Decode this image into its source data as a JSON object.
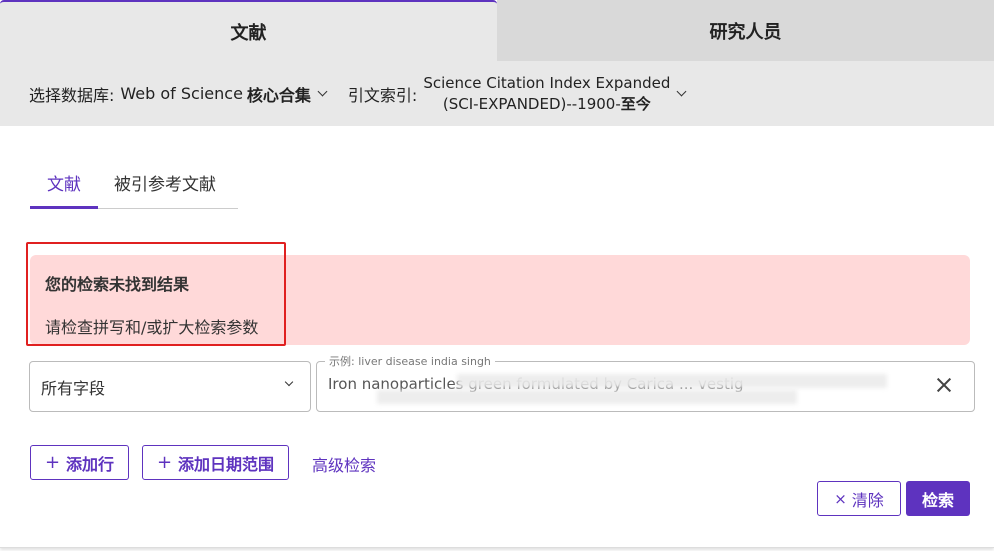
{
  "top_tabs": [
    {
      "label": "文献",
      "active": true
    },
    {
      "label": "研究人员",
      "active": false
    }
  ],
  "db_bar": {
    "db_label": "选择数据库:",
    "db_value_prefix": "Web of Science",
    "db_value_bold": "核心合集",
    "cite_label": "引文索引:",
    "cite_line1": "Science Citation Index Expanded",
    "cite_line2_prefix": "(SCI-EXPANDED)--1900-",
    "cite_line2_bold": "至今"
  },
  "sub_tabs": [
    {
      "label": "文献",
      "active": true
    },
    {
      "label": "被引参考文献",
      "active": false
    }
  ],
  "alert": {
    "title": "您的检索未找到结果",
    "message": "请检查拼写和/或扩大检索参数"
  },
  "search": {
    "field_value": "所有字段",
    "legend": "示例: liver disease india singh",
    "query_value": "Iron nanoparticles green formulated by Carica ...                                   vestig"
  },
  "buttons": {
    "add_row": "添加行",
    "add_date_range": "添加日期范围",
    "advanced_search": "高级检索",
    "clear": "清除",
    "search": "检索"
  },
  "colors": {
    "accent": "#5e33bf",
    "alert_bg": "#ffd9d9",
    "highlight_box": "#e02020"
  }
}
